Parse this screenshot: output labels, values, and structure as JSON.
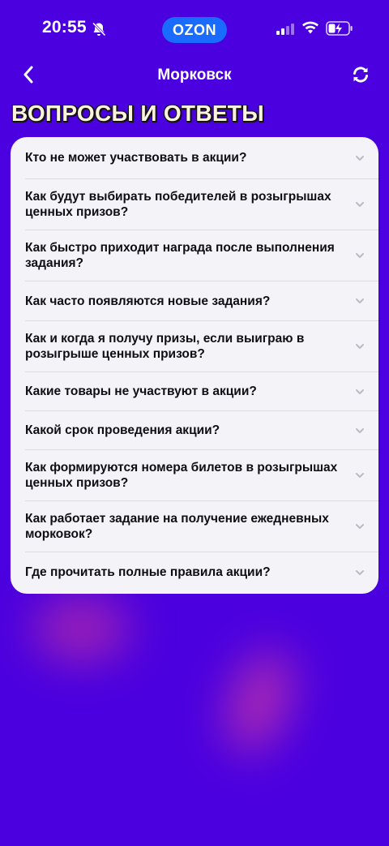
{
  "status_bar": {
    "time": "20:55",
    "center_badge": "OZON",
    "icons": [
      "bell-off-icon",
      "signal-icon",
      "wifi-icon",
      "battery-charging-icon"
    ]
  },
  "nav": {
    "title": "Морковск",
    "back_icon": "chevron-left-icon",
    "refresh_icon": "refresh-icon"
  },
  "heading": "ВОПРОСЫ И ОТВЕТЫ",
  "faq": [
    {
      "question": "Кто не может участвовать в акции?"
    },
    {
      "question": "Как будут выбирать победителей в розыгрышах ценных призов?"
    },
    {
      "question": "Как быстро приходит награда после выполнения задания?"
    },
    {
      "question": "Как часто появляются новые задания?"
    },
    {
      "question": "Как и когда я получу призы, если выиграю в розыгрыше ценных призов?"
    },
    {
      "question": "Какие товары не участвуют в акции?"
    },
    {
      "question": "Какой срок проведения акции?"
    },
    {
      "question": "Как формируются номера билетов в розыгрышах ценных призов?"
    },
    {
      "question": "Как работает задание на получение ежедневных морковок?"
    },
    {
      "question": "Где прочитать полные правила акции?"
    }
  ],
  "colors": {
    "background": "#4B00DF",
    "card": "#F4F4F8",
    "ozon_badge": "#1A6BFF",
    "heading_fill": "#FCF3DF"
  }
}
